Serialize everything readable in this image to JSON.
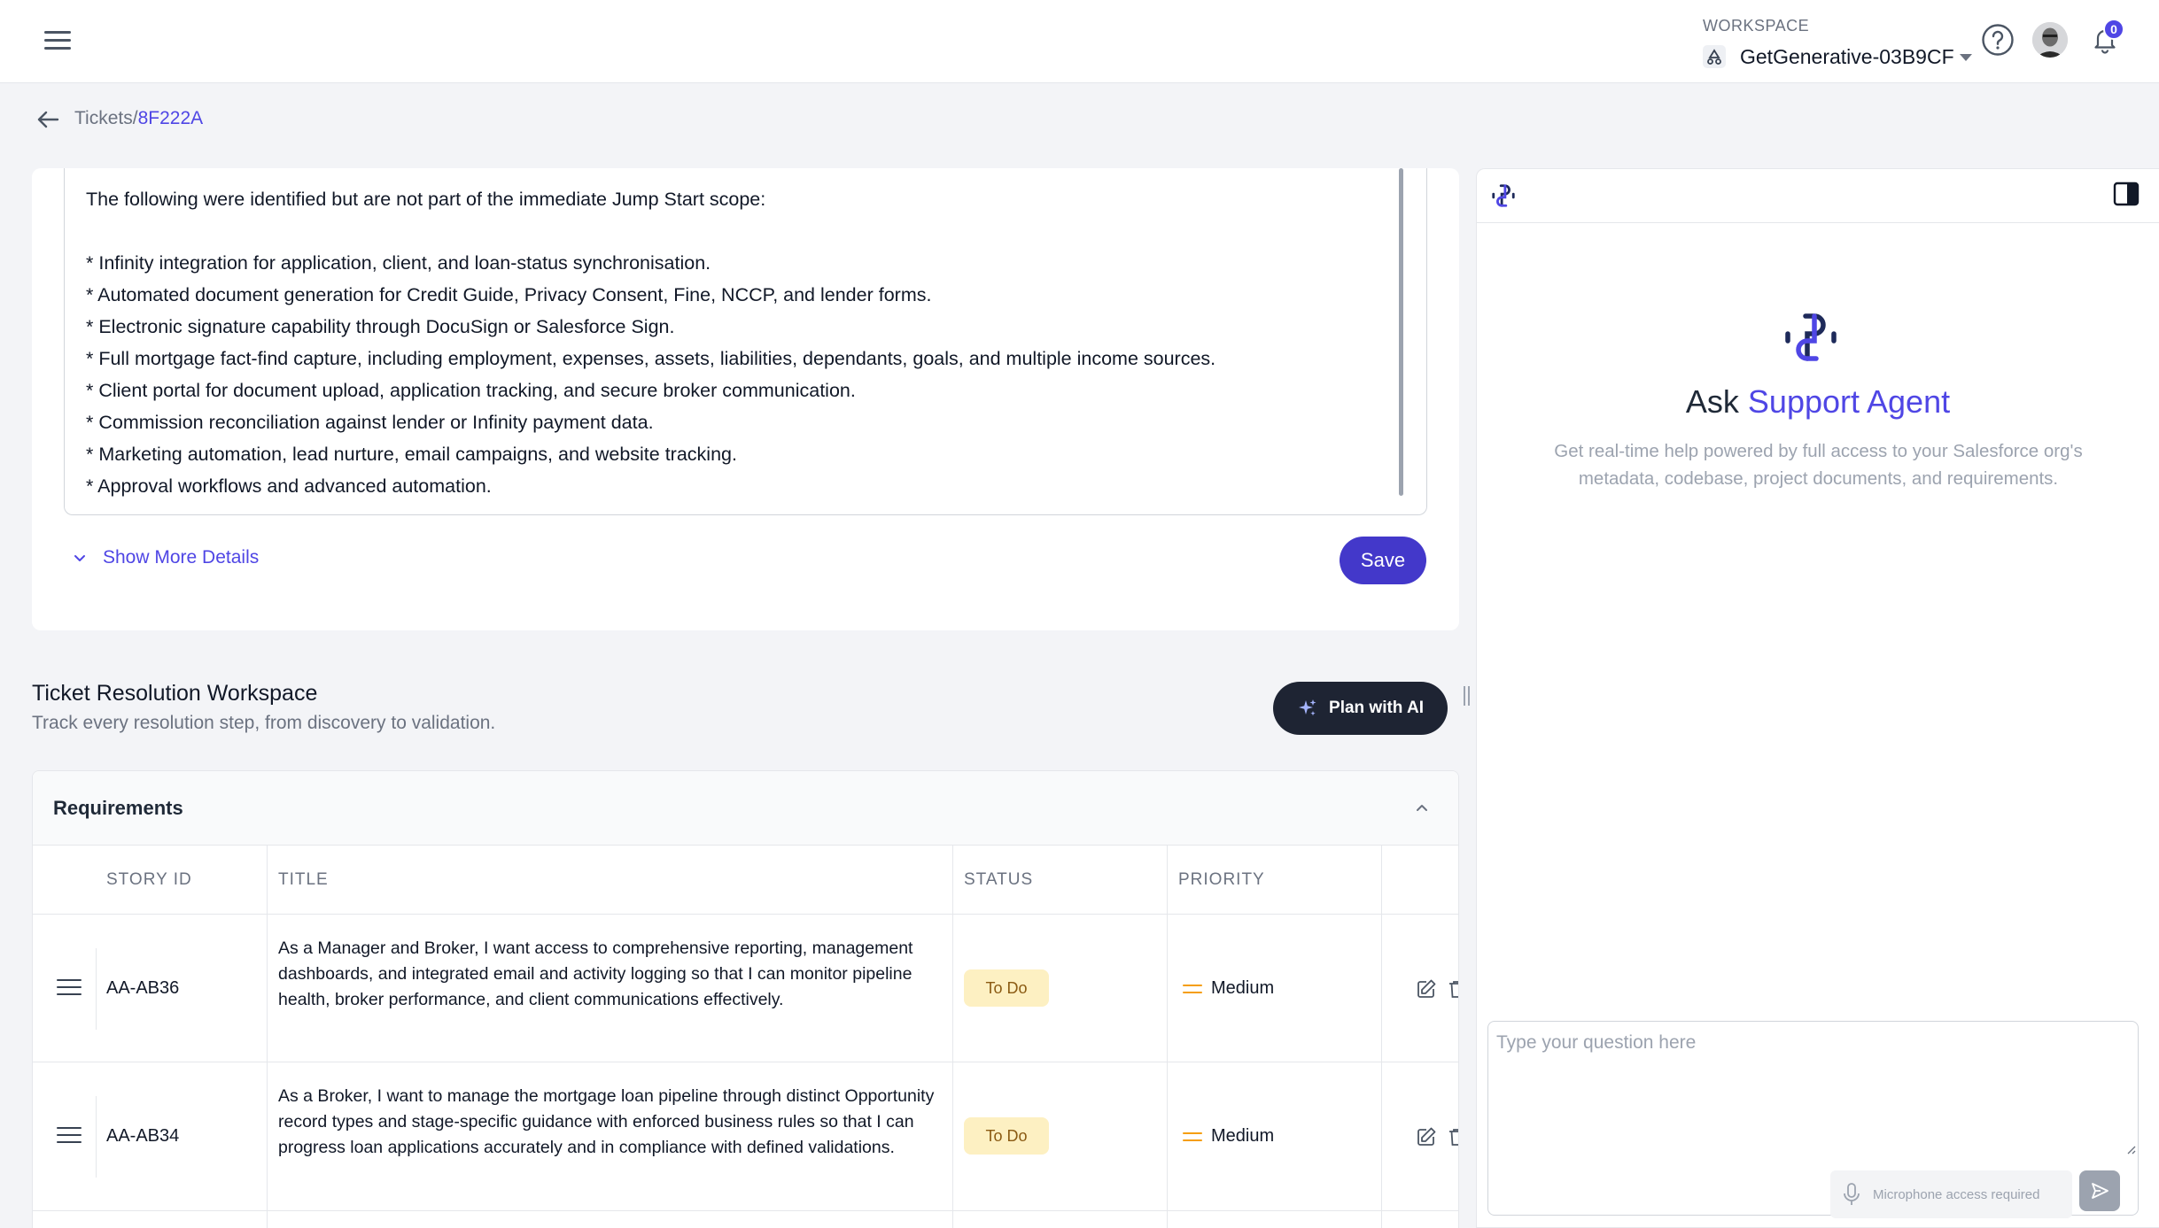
{
  "header": {
    "workspace_label": "WORKSPACE",
    "workspace_name": "GetGenerative-03B9CF",
    "notification_count": "0"
  },
  "breadcrumb": {
    "parent": "Tickets",
    "separator": "/",
    "current": "8F222A"
  },
  "description": {
    "intro": "The following were identified but are not part of the immediate Jump Start scope:",
    "items": [
      "* Infinity integration for application, client, and loan-status synchronisation.",
      "* Automated document generation for Credit Guide, Privacy Consent, Fine, NCCP, and lender forms.",
      "* Electronic signature capability through DocuSign or Salesforce Sign.",
      "* Full mortgage fact-find capture, including employment, expenses, assets, liabilities, dependants, goals, and multiple income sources.",
      "* Client portal for document upload, application tracking, and secure broker communication.",
      "* Commission reconciliation against lender or Infinity payment data.",
      "* Marketing automation, lead nurture, email campaigns, and website tracking.",
      "* Approval workflows and advanced automation."
    ],
    "show_more_label": "Show More Details",
    "save_label": "Save"
  },
  "resolution": {
    "title": "Ticket Resolution Workspace",
    "subtitle": "Track every resolution step, from discovery to validation.",
    "plan_label": "Plan with AI"
  },
  "requirements": {
    "title": "Requirements",
    "columns": {
      "story_id": "STORY ID",
      "title": "TITLE",
      "status": "STATUS",
      "priority": "PRIORITY"
    },
    "rows": [
      {
        "story_id": "AA-AB36",
        "title": "As a Manager and Broker, I want access to comprehensive reporting, management dashboards, and integrated email and activity logging so that I can monitor pipeline health, broker performance, and client communications effectively.",
        "status": "To Do",
        "priority": "Medium"
      },
      {
        "story_id": "AA-AB34",
        "title": "As a Broker, I want to manage the mortgage loan pipeline through distinct Opportunity record types and stage-specific guidance with enforced business rules so that I can progress loan applications accurately and in compliance with defined validations.",
        "status": "To Do",
        "priority": "Medium"
      }
    ]
  },
  "agent": {
    "heading_prefix": "Ask ",
    "heading_highlight": "Support Agent",
    "description": "Get real-time help powered by full access to your Salesforce org's metadata, codebase, project documents, and requirements.",
    "input_placeholder": "Type your question here",
    "mic_label": "Microphone access required"
  },
  "colors": {
    "accent": "#4f46e5",
    "dark_button": "#1e2433",
    "status_todo_bg": "#fdf0c2",
    "priority_medium": "#f59e0b"
  }
}
